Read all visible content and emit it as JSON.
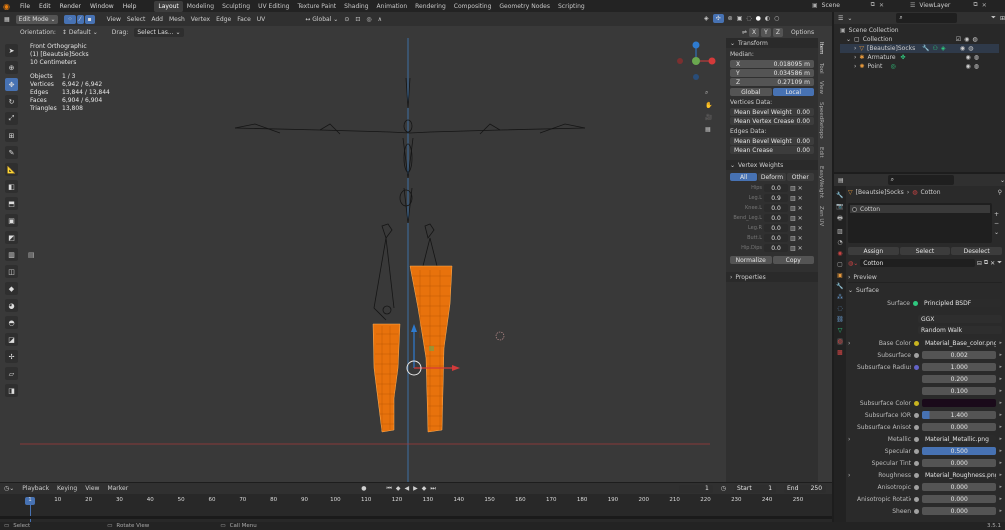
{
  "menu": {
    "items": [
      "File",
      "Edit",
      "Render",
      "Window",
      "Help"
    ]
  },
  "workspaces": [
    {
      "label": "Layout",
      "active": true
    },
    {
      "label": "Modeling"
    },
    {
      "label": "Sculpting"
    },
    {
      "label": "UV Editing"
    },
    {
      "label": "Texture Paint"
    },
    {
      "label": "Shading"
    },
    {
      "label": "Animation"
    },
    {
      "label": "Rendering"
    },
    {
      "label": "Compositing"
    },
    {
      "label": "Geometry Nodes"
    },
    {
      "label": "Scripting"
    }
  ],
  "scene": {
    "scene_label": "Scene",
    "view_layer_label": "ViewLayer"
  },
  "viewport_header": {
    "mode": "Edit Mode",
    "menus": [
      "View",
      "Select",
      "Add",
      "Mesh",
      "Vertex",
      "Edge",
      "Face",
      "UV"
    ],
    "transform": "Global"
  },
  "tool_settings": {
    "orientation_label": "Orientation:",
    "orientation_value": "Default",
    "drag_label": "Drag:",
    "drag_value": "Select Las...",
    "options": "Options"
  },
  "axes": {
    "x": "X",
    "y": "Y",
    "z": "Z"
  },
  "overlay": {
    "view_name": "Front Orthographic",
    "object_name": "(1) [Beautsie]Socks",
    "scale": "10 Centimeters",
    "stats": [
      {
        "label": "Objects",
        "value": "1 / 3"
      },
      {
        "label": "Vertices",
        "value": "6,942 / 6,942"
      },
      {
        "label": "Edges",
        "value": "13,844 / 13,844"
      },
      {
        "label": "Faces",
        "value": "6,904 / 6,904"
      },
      {
        "label": "Triangles",
        "value": "13,808"
      }
    ]
  },
  "npanel": {
    "transform_title": "Transform",
    "median_label": "Median:",
    "median": [
      {
        "axis": "X",
        "value": "0.018095 m"
      },
      {
        "axis": "Y",
        "value": "0.034586 m"
      },
      {
        "axis": "Z",
        "value": "0.27109 m"
      }
    ],
    "space_global": "Global",
    "space_local": "Local",
    "vertices_data_label": "Vertices Data:",
    "vertices_data": [
      {
        "label": "Mean Bevel Weight",
        "value": "0.00"
      },
      {
        "label": "Mean Vertex Crease",
        "value": "0.00"
      }
    ],
    "edges_data_label": "Edges Data:",
    "edges_data": [
      {
        "label": "Mean Bevel Weight",
        "value": "0.00"
      },
      {
        "label": "Mean Crease",
        "value": "0.00"
      }
    ],
    "vertex_weights_title": "Vertex Weights",
    "vw_tabs": [
      "All",
      "Deform",
      "Other"
    ],
    "vw_rows": [
      {
        "name": "Hips",
        "value": "0.0"
      },
      {
        "name": "Leg.L",
        "value": "0.9"
      },
      {
        "name": "Knee.L",
        "value": "0.0"
      },
      {
        "name": "Bend_Leg.L",
        "value": "0.0"
      },
      {
        "name": "Leg.R",
        "value": "0.0"
      },
      {
        "name": "Butt.L",
        "value": "0.0"
      },
      {
        "name": "Hip.Dips",
        "value": "0.0"
      }
    ],
    "normalize": "Normalize",
    "copy": "Copy",
    "properties_title": "Properties",
    "tabs": [
      "Item",
      "Tool",
      "View",
      "SpeedRetopo",
      "Edit",
      "EasyWeight",
      "Zen UV"
    ]
  },
  "outliner": {
    "scene_collection": "Scene Collection",
    "collection": "Collection",
    "items": [
      "[Beautsie]Socks",
      "Armature",
      "Point"
    ]
  },
  "properties": {
    "breadcrumb_object": "[Beautsie]Socks",
    "breadcrumb_material": "Cotton",
    "slot_name": "Cotton",
    "assign": "Assign",
    "select": "Select",
    "deselect": "Deselect",
    "material_name": "Cotton",
    "preview_title": "Preview",
    "surface_title": "Surface",
    "surface_label": "Surface",
    "surface_value": "Principled BSDF",
    "distribution": "GGX",
    "subsurface_method": "Random Walk",
    "rows": [
      {
        "label": "Base Color",
        "value": "Material_Base_color.png...",
        "kind": "tex",
        "dot": "#c8b420",
        "arrow": true
      },
      {
        "label": "Subsurface",
        "value": "0.002",
        "kind": "num",
        "dot": "#a1a1a1"
      },
      {
        "label": "Subsurface Radius",
        "value": "1.000",
        "kind": "num",
        "dot": "#6363c7"
      },
      {
        "label": "",
        "value": "0.200",
        "kind": "num",
        "dot": ""
      },
      {
        "label": "",
        "value": "0.100",
        "kind": "num",
        "dot": ""
      },
      {
        "label": "Subsurface Color",
        "value": "",
        "kind": "color",
        "dot": "#c8b420"
      },
      {
        "label": "Subsurface IOR",
        "value": "1.400",
        "kind": "num",
        "dot": "#a1a1a1"
      },
      {
        "label": "Subsurface Anisot...",
        "value": "0.000",
        "kind": "num",
        "dot": "#a1a1a1"
      },
      {
        "label": "Metallic",
        "value": "Material_Metallic.png",
        "kind": "tex",
        "dot": "#a1a1a1",
        "arrow": true
      },
      {
        "label": "Specular",
        "value": "0.500",
        "kind": "blue",
        "dot": "#a1a1a1"
      },
      {
        "label": "Specular Tint",
        "value": "0.000",
        "kind": "num",
        "dot": "#a1a1a1"
      },
      {
        "label": "Roughness",
        "value": "Material_Roughness.png",
        "kind": "tex",
        "dot": "#a1a1a1",
        "arrow": true
      },
      {
        "label": "Anisotropic",
        "value": "0.000",
        "kind": "num",
        "dot": "#a1a1a1"
      },
      {
        "label": "Anisotropic Rotation",
        "value": "0.000",
        "kind": "num",
        "dot": "#a1a1a1"
      },
      {
        "label": "Sheen",
        "value": "0.000",
        "kind": "num",
        "dot": "#a1a1a1"
      }
    ],
    "subsurface_ior_fill": 0.1
  },
  "timeline": {
    "menus": [
      "Playback",
      "Keying",
      "View",
      "Marker"
    ],
    "current_frame": "1",
    "start_label": "Start",
    "start": "1",
    "end_label": "End",
    "end": "250",
    "ticks": [
      "1",
      "10",
      "20",
      "30",
      "40",
      "50",
      "60",
      "70",
      "80",
      "90",
      "100",
      "110",
      "120",
      "130",
      "140",
      "150",
      "160",
      "170",
      "180",
      "190",
      "200",
      "210",
      "220",
      "230",
      "240",
      "250"
    ]
  },
  "statusbar": {
    "select": "Select",
    "rotate": "Rotate View",
    "menu": "Call Menu",
    "version": "3.5.1"
  },
  "colors": {
    "accent": "#4772b3",
    "orange": "#ff8a00",
    "mesh": "#e8720c"
  }
}
